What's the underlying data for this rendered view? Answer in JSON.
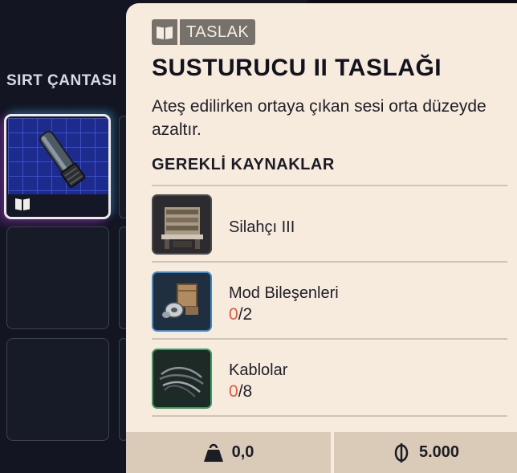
{
  "inventory": {
    "title": "SIRT ÇANTASI"
  },
  "detail": {
    "badge_label": "TASLAK",
    "title": "SUSTURUCU II TASLAĞI",
    "description": "Ateş edilirken ortaya çıkan sesi orta düzeyde azaltır.",
    "requirements_title": "GEREKLİ KAYNAKLAR",
    "requirements": [
      {
        "name": "Silahçı III",
        "have": "",
        "need": ""
      },
      {
        "name": "Mod Bileşenleri",
        "have": "0",
        "need": "/2"
      },
      {
        "name": "Kablolar",
        "have": "0",
        "need": "/8"
      }
    ]
  },
  "footer": {
    "weight": "0,0",
    "price": "5.000"
  },
  "colors": {
    "card_bg": "#f7ebdd",
    "footer_bg": "#dacbb9",
    "missing_count": "#e0593b",
    "badge_bg": "#77716b",
    "panel_bg": "#131523"
  }
}
